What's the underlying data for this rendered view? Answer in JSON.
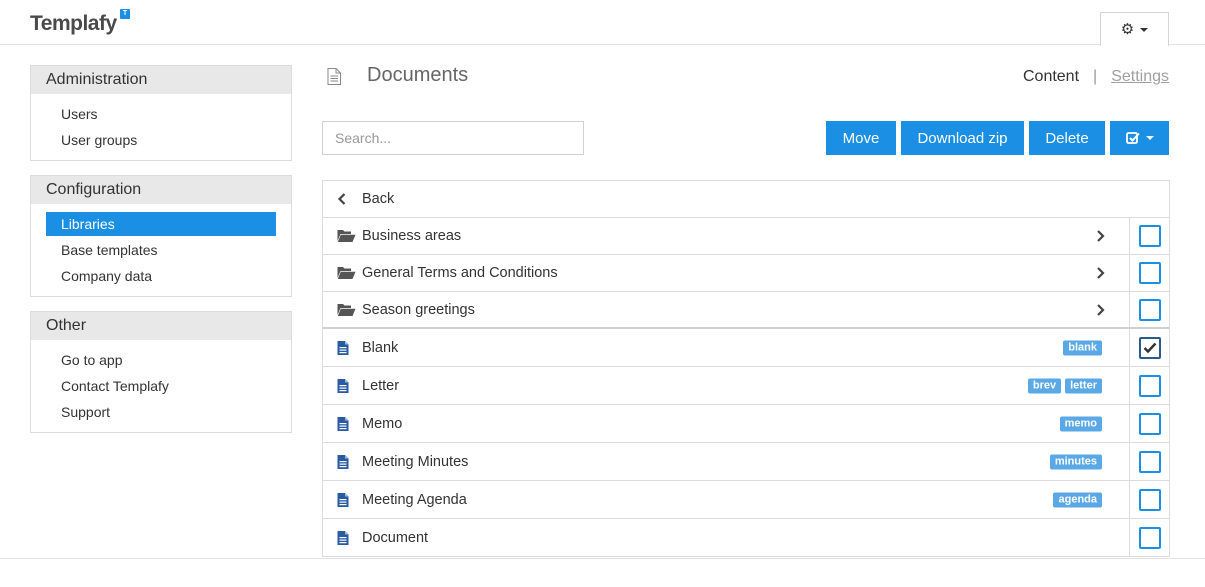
{
  "header": {
    "logo_text": "Templafy",
    "logo_badge": "T",
    "settings_icon": "gear-icon"
  },
  "sidebar": {
    "administration": {
      "title": "Administration",
      "items": [
        "Users",
        "User groups"
      ]
    },
    "configuration": {
      "title": "Configuration",
      "items": [
        "Libraries",
        "Base templates",
        "Company data"
      ],
      "active": "Libraries"
    },
    "other": {
      "title": "Other",
      "items": [
        "Go to app",
        "Contact Templafy",
        "Support"
      ]
    }
  },
  "main": {
    "title": "Documents",
    "view_content": "Content",
    "view_separator": "|",
    "view_settings": "Settings",
    "search_placeholder": "Search...",
    "buttons": {
      "move": "Move",
      "download_zip": "Download zip",
      "delete": "Delete"
    },
    "back_label": "Back",
    "folders": [
      {
        "name": "Business areas",
        "checked": false
      },
      {
        "name": "General Terms and Conditions",
        "checked": false
      },
      {
        "name": "Season greetings",
        "checked": false
      }
    ],
    "documents": [
      {
        "name": "Blank",
        "tags": [
          "blank"
        ],
        "checked": true
      },
      {
        "name": "Letter",
        "tags": [
          "brev",
          "letter"
        ],
        "checked": false
      },
      {
        "name": "Memo",
        "tags": [
          "memo"
        ],
        "checked": false
      },
      {
        "name": "Meeting Minutes",
        "tags": [
          "minutes"
        ],
        "checked": false
      },
      {
        "name": "Meeting Agenda",
        "tags": [
          "agenda"
        ],
        "checked": false
      },
      {
        "name": "Document",
        "tags": [],
        "checked": false
      }
    ]
  },
  "colors": {
    "accent": "#1a8fe3",
    "tag": "#5aa9e6",
    "panel_header": "#e8e8e8"
  }
}
